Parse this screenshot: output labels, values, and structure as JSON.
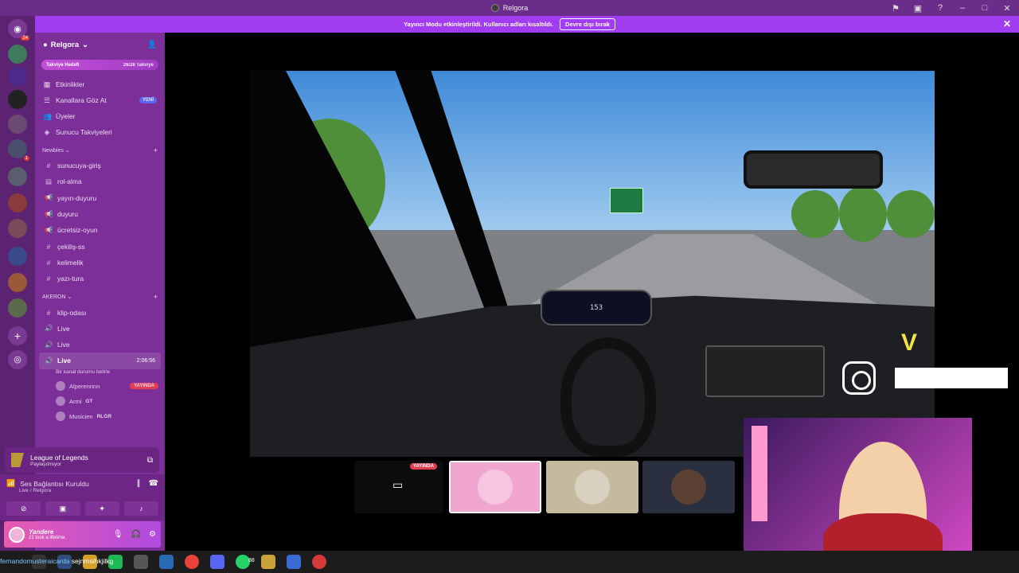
{
  "window": {
    "title": "Relgora"
  },
  "banner": {
    "text": "Yayıncı Modu etkinleştirildi. Kullanıcı adları kısaltıldı.",
    "button": "Devre dışı bırak"
  },
  "rail": {
    "home_badge": "24",
    "server_badge": "1"
  },
  "server": {
    "name": "Relgora",
    "boost_goal_label": "Takviye Hedefi",
    "boost_goal_count": "26/28 Takviye"
  },
  "nav": [
    {
      "icon": "calendar-icon",
      "label": "Etkinlikler"
    },
    {
      "icon": "browse-icon",
      "label": "Kanallara Göz At",
      "badge": "YENİ"
    },
    {
      "icon": "members-icon",
      "label": "Üyeler"
    },
    {
      "icon": "boost-icon",
      "label": "Sunucu Takviyeleri"
    }
  ],
  "categories": [
    {
      "name": "Newbies",
      "channels": [
        {
          "type": "text",
          "label": "sunucuya-giriş"
        },
        {
          "type": "text",
          "label": "rol-alma"
        },
        {
          "type": "announcement",
          "label": "yayın-duyuru"
        },
        {
          "type": "announcement",
          "label": "duyuru"
        },
        {
          "type": "announcement",
          "label": "ücretsiz-oyun"
        },
        {
          "type": "text",
          "label": "çekiliş-ss"
        },
        {
          "type": "text",
          "label": "kelimelik"
        },
        {
          "type": "text",
          "label": "yazı-tura"
        }
      ]
    },
    {
      "name": "AKERON",
      "channels": [
        {
          "type": "text",
          "label": "klip-odası"
        },
        {
          "type": "voice",
          "label": "Live"
        },
        {
          "type": "voice",
          "label": "Live"
        }
      ]
    }
  ],
  "active_channel": {
    "label": "Live",
    "time": "2:06:56",
    "status": "Bir kanal durumu belirle"
  },
  "members": [
    {
      "name": "Alperennnn",
      "badge": "YAYINDA"
    },
    {
      "name": "Armi",
      "tag": "GT"
    },
    {
      "name": "Musicien",
      "tag": "RLGR"
    }
  ],
  "activity": {
    "title": "League of Legends",
    "subtitle": "Paylaşılmıyor"
  },
  "voice": {
    "status": "Ses Bağlantısı Kuruldu",
    "location": "Live / Relgora"
  },
  "user": {
    "name": "Yandere",
    "status": "21 took a lifetime."
  },
  "stream": {
    "speed": "153",
    "live_badge": "YAYINDA"
  },
  "taskbar": {
    "ticker_user": "fernandomusteraicarda",
    "ticker_text": "sejnmsihkjilkg",
    "whatsapp_badge": "88"
  },
  "colors": {
    "titlebar": "#6b2d8a",
    "banner": "#a23cf0",
    "sidebar": "#7d2f99",
    "live": "#e33d54",
    "new_badge": "#5865f2"
  }
}
